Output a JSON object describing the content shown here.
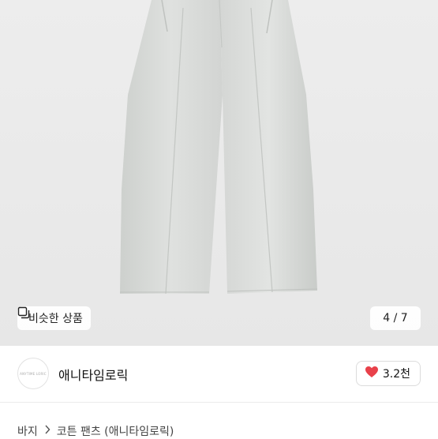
{
  "gallery": {
    "similar_button_label": "비슷한 상품",
    "counter": "4 / 7"
  },
  "shop": {
    "avatar_text": "ANYTIME LORIC",
    "name": "애니타임로릭",
    "likes": "3.2천"
  },
  "breadcrumb": {
    "items": [
      "바지",
      "코튼 팬츠 (애니타임로릭)"
    ],
    "separator_icon": "chevron-right-icon"
  },
  "colors": {
    "heart": "#e8414a",
    "photo_bg": "#e9e9e9",
    "pants": "#d9dbd9"
  }
}
